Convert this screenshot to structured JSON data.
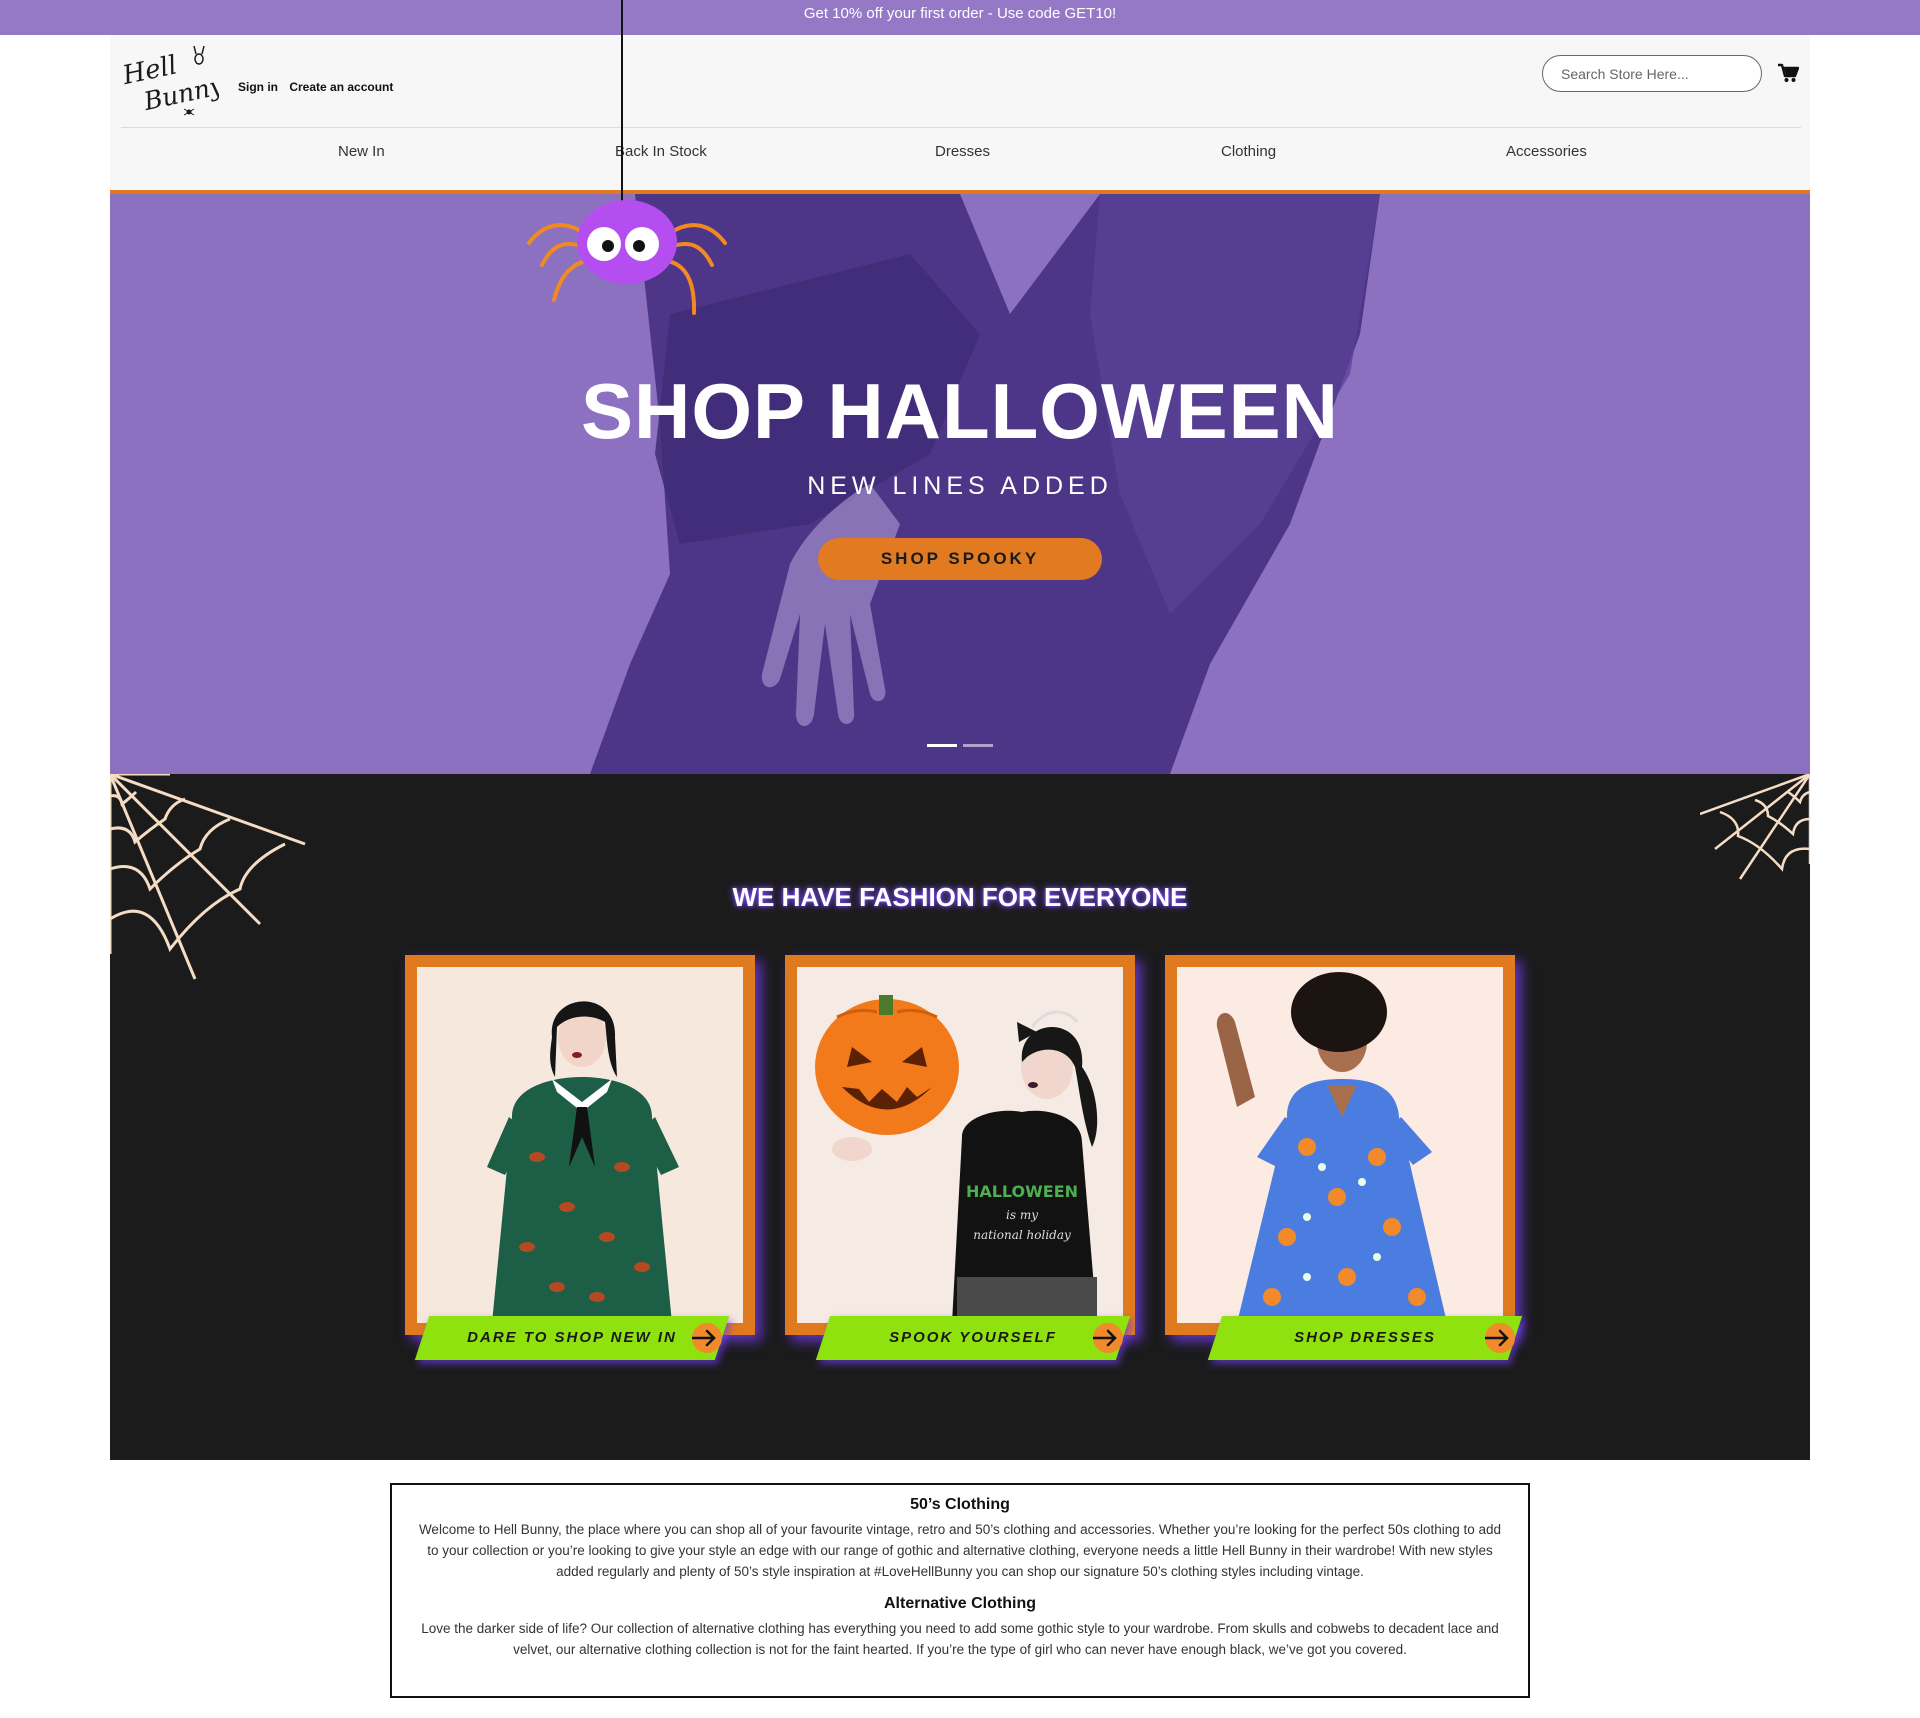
{
  "promo": {
    "text": "Get 10% off your first order - Use code GET10!"
  },
  "header": {
    "logo_text": "Hell Bunny",
    "sign_in": "Sign in",
    "create_account": "Create an account",
    "search_placeholder": "Search Store Here...",
    "cart_icon": "cart-icon",
    "nav": [
      "New In",
      "Back In Stock",
      "Dresses",
      "Clothing",
      "Accessories"
    ]
  },
  "hero": {
    "title": "SHOP HALLOWEEN",
    "subtitle": "NEW LINES ADDED",
    "button": "SHOP SPOOKY",
    "slides": 2,
    "active_slide": 1
  },
  "fashion": {
    "title": "WE HAVE FASHION FOR EVERYONE",
    "cards": [
      {
        "label": "DARE TO SHOP NEW IN"
      },
      {
        "label": "SPOOK YOURSELF"
      },
      {
        "label": "SHOP DRESSES"
      }
    ]
  },
  "info": {
    "heading1": "50’s Clothing",
    "para1": "Welcome to Hell Bunny, the place where you can shop all of your favourite vintage, retro and 50’s clothing and accessories. Whether you’re looking for the perfect 50s clothing to add to your collection or you’re looking to give your style an edge with our range of gothic and alternative clothing, everyone needs a little Hell Bunny in their wardrobe! With new styles added regularly and plenty of 50’s style inspiration at #LoveHellBunny you can shop our signature 50’s clothing styles including vintage.",
    "heading2": "Alternative Clothing",
    "para2": "Love the darker side of life? Our collection of alternative clothing has everything you need to add some gothic style to your wardrobe. From skulls and cobwebs to decadent lace and velvet, our alternative clothing collection is not for the faint hearted. If you’re the type of girl who can never have enough black, we’ve got you covered."
  },
  "colors": {
    "promo_bg": "#9579c7",
    "accent_orange": "#e07a1f",
    "hero_purple": "#8a70be",
    "button_green": "#8fe20d",
    "dark_bg": "#1b1b1b"
  }
}
